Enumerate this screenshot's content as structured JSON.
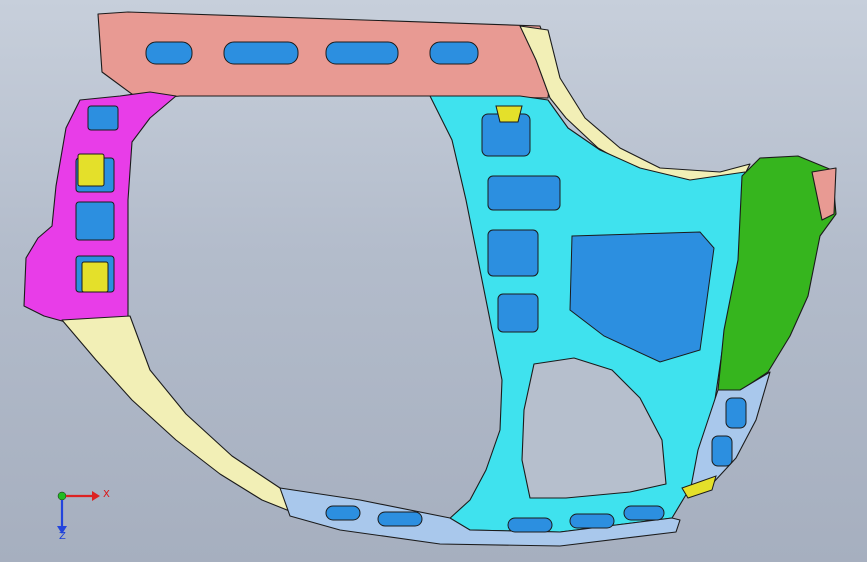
{
  "viewport": {
    "background_top": "#c7cfdb",
    "background_bottom": "#a6afbf"
  },
  "model": {
    "parts": [
      {
        "id": "roof-rail",
        "color": "#e89a93"
      },
      {
        "id": "a-pillar-inner",
        "color": "#e83de8"
      },
      {
        "id": "body-side-inner",
        "color": "#3fe2ee"
      },
      {
        "id": "rear-quarter-inner",
        "color": "#36b51e"
      },
      {
        "id": "sill-and-pillar-trim",
        "color": "#f2efb6"
      },
      {
        "id": "lower-sill",
        "color": "#a9c8ec"
      }
    ],
    "hole_color": "#2c8fe0",
    "edge_color": "#1b1b1b"
  },
  "axis_triad": {
    "x_label": "X",
    "y_label": "Z",
    "x_color": "#dd2222",
    "y_color": "#2244dd",
    "origin_color": "#22bb22"
  }
}
